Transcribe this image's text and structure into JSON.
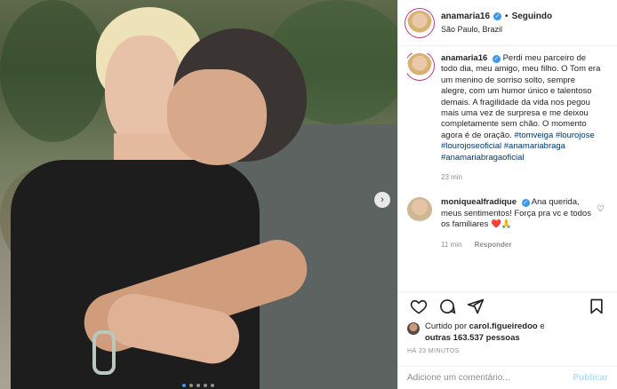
{
  "post": {
    "image_alt": "Photo of a man kissing the cheek of a blonde woman",
    "nav_arrow": "›",
    "carousel_dots": 5,
    "carousel_active": 1
  },
  "header": {
    "username": "anamaria16",
    "separator": "•",
    "follow_label": "Seguindo",
    "location": "São Paulo, Brazil",
    "verified_icon": "verified-badge-icon"
  },
  "caption": {
    "username": "anamaria16",
    "text": "Perdi meu parceiro de todo dia, meu amigo, meu filho. O Tom era um menino de sorriso solto, sempre alegre, com um humor único e talentoso demais. A fragilidade da vida nos pegou mais uma vez de surpresa e me deixou completamente sem chão. O momento agora é de oração.",
    "hashtags": [
      "#tomveiga",
      "#lourojose",
      "#lourojoseoficial",
      "#anamariabraga",
      "#anamariabragaoficial"
    ],
    "time": "23 min"
  },
  "comment": {
    "username": "moniquealfradique",
    "text": "Ana querida, meus sentimentos! Força pra vc e todos os familiares",
    "emoji": "❤️🙏",
    "time": "11 min",
    "reply_label": "Responder"
  },
  "likes": {
    "liked_by_prefix": "Curtido por",
    "liked_by_user": "carol.figueiredoo",
    "conjunction": "e",
    "others": "outras 163.537 pessoas"
  },
  "timestamp": "HÁ 23 MINUTOS",
  "add_comment": {
    "placeholder": "Adicione um comentário...",
    "publish_label": "Publicar"
  },
  "colors": {
    "link": "#00376b",
    "verified": "#3897f0",
    "publish_disabled": "#b2dffc",
    "muted": "#8e8e8e"
  }
}
